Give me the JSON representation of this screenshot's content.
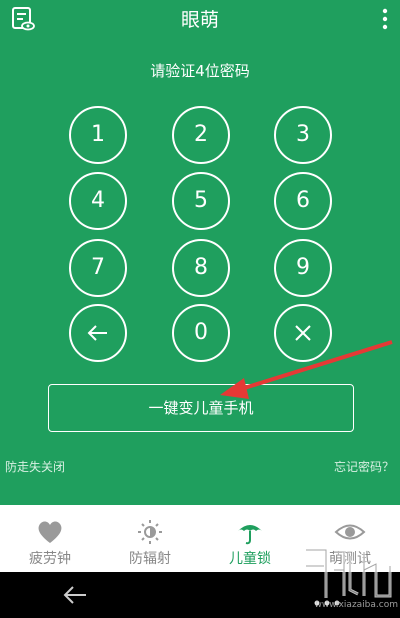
{
  "app": {
    "title": "眼萌"
  },
  "header": {
    "left_icon": "notes-eye-icon",
    "right_icon": "more-vertical-icon"
  },
  "prompt": "请验证4位密码",
  "keypad": {
    "keys": [
      "1",
      "2",
      "3",
      "4",
      "5",
      "6",
      "7",
      "8",
      "9"
    ],
    "back_icon": "arrow-left-icon",
    "zero": "0",
    "clear_icon": "close-icon"
  },
  "one_key_button": "一键变儿童手机",
  "footer": {
    "anti_lose_label": "防走失关闭",
    "forgot_label": "忘记密码？"
  },
  "bottom_nav": [
    {
      "label": "疲劳钟",
      "icon": "heart-icon",
      "active": false
    },
    {
      "label": "防辐射",
      "icon": "sun-icon",
      "active": false
    },
    {
      "label": "儿童锁",
      "icon": "umbrella-icon",
      "active": true
    },
    {
      "label": "萌测试",
      "icon": "eye-icon",
      "active": false
    }
  ],
  "system_bar": {
    "back_icon": "back-arrow-icon",
    "menu_icon": "dots-icon"
  },
  "watermark": {
    "text": "www.xiazaiba.com"
  },
  "colors": {
    "primary": "#1f9f5e",
    "nav_bg": "#ffffff",
    "inactive": "#888888",
    "arrow": "#e53935"
  }
}
